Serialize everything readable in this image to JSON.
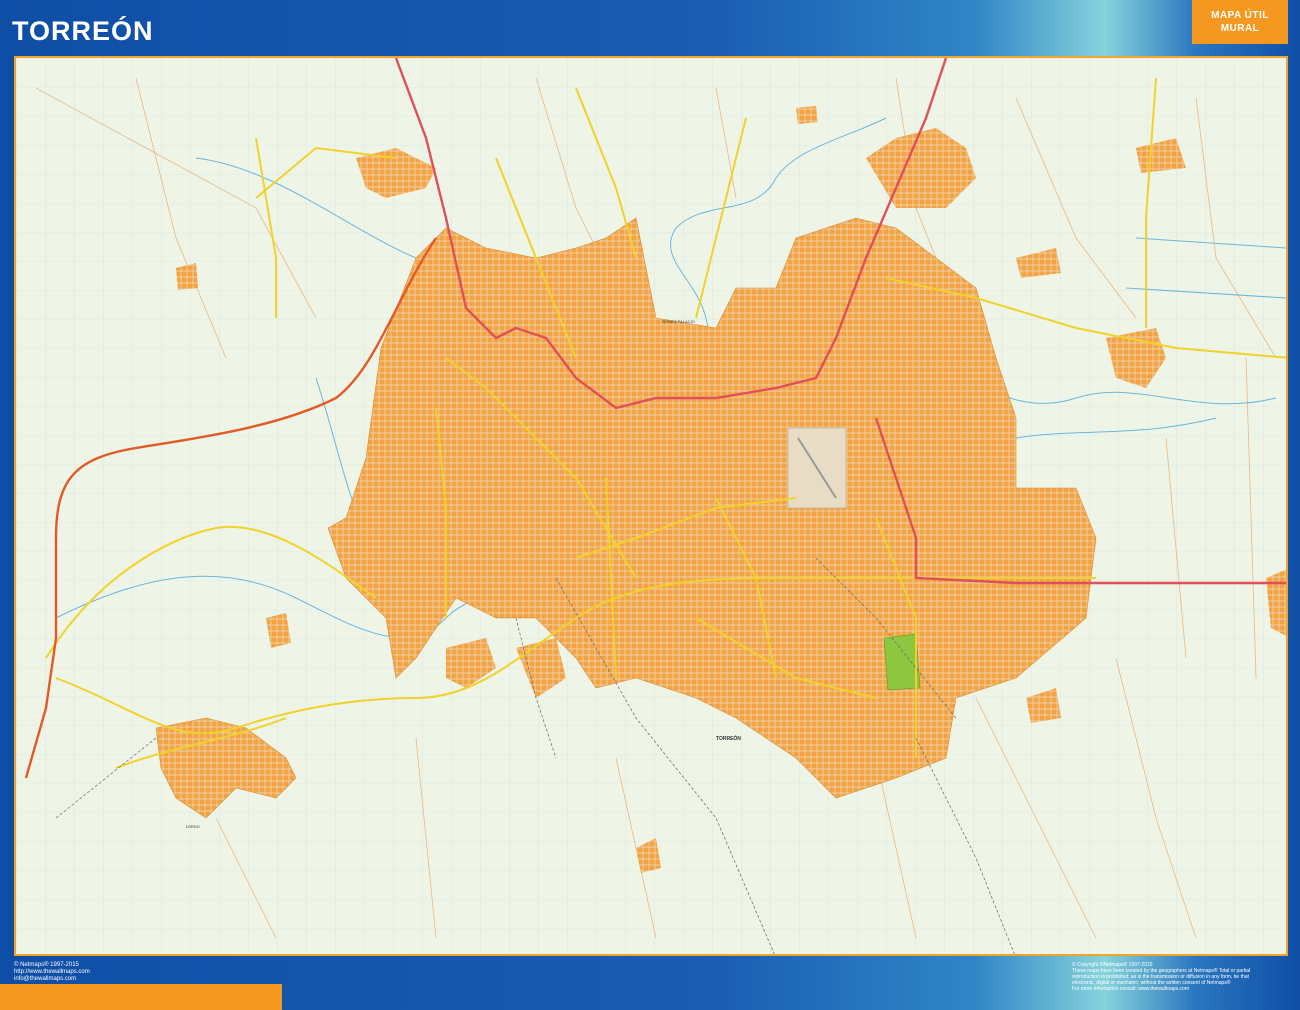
{
  "header": {
    "title": "TORREÓN",
    "badge_line1": "MAPA ÚTIL",
    "badge_line2": "MURAL"
  },
  "map": {
    "city_label": "TORREÓN",
    "labels": [
      "GÓMEZ PALACIO",
      "LERDO"
    ]
  },
  "footer": {
    "left_line1": "© Netmaps® 1997-2015",
    "left_line2": "http://www.thewallmaps.com",
    "left_line3": "info@thewallmaps.com",
    "right_line1": "© Copyright ©Netmaps® 1997-2015",
    "right_line2": "These maps have been created by the geographers at Netmaps® Total or partial",
    "right_line3": "reproduction is prohibited; as is the transmission or diffusion in any form, be that",
    "right_line4": "electronic, digital or mechanic; without the written consent of Netmaps®",
    "right_line5": "For more information consult: www.thewallmaps.com"
  },
  "colors": {
    "frame_blue": "#1552a8",
    "accent_orange": "#f4981f",
    "urban": "#f4a340",
    "map_bg": "#eef5e6",
    "highway_red": "#e0505a",
    "road_yellow": "#f2d22a",
    "river": "#6ab7de",
    "park": "#8dc63f"
  }
}
